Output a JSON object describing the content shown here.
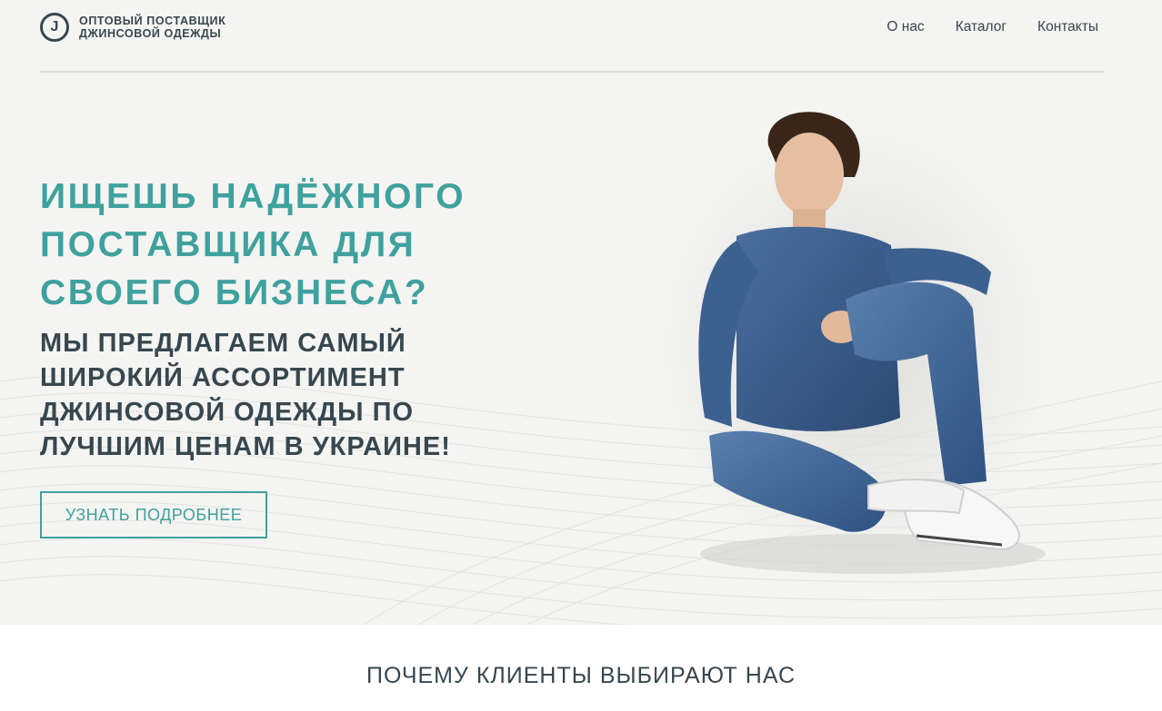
{
  "header": {
    "logo_letter": "J",
    "logo_line1": "ОПТОВЫЙ ПОСТАВЩИК",
    "logo_line2": "ДЖИНСОВОЙ ОДЕЖДЫ",
    "nav": [
      {
        "label": "О нас"
      },
      {
        "label": "Каталог"
      },
      {
        "label": "Контакты"
      }
    ]
  },
  "hero": {
    "headline_lines": [
      "ИЩЕШЬ НАДЁЖНОГО",
      "ПОСТАВЩИКА ДЛЯ",
      "СВОЕГО БИЗНЕСА?"
    ],
    "subheadline_lines": [
      "МЫ ПРЕДЛАГАЕМ САМЫЙ",
      "ШИРОКИЙ АССОРТИМЕНТ",
      "ДЖИНСОВОЙ ОДЕЖДЫ ПО",
      "ЛУЧШИМ ЦЕНАМ В УКРАИНЕ!"
    ],
    "cta_label": "УЗНАТЬ ПОДРОБНЕЕ",
    "image_alt": "model-in-denim-outfit"
  },
  "section": {
    "title": "ПОЧЕМУ КЛИЕНТЫ ВЫБИРАЮТ НАС"
  },
  "colors": {
    "accent": "#3fa19e",
    "text": "#37474f",
    "hero_bg": "#f4f4f2",
    "denim": "#3b5f8e"
  }
}
